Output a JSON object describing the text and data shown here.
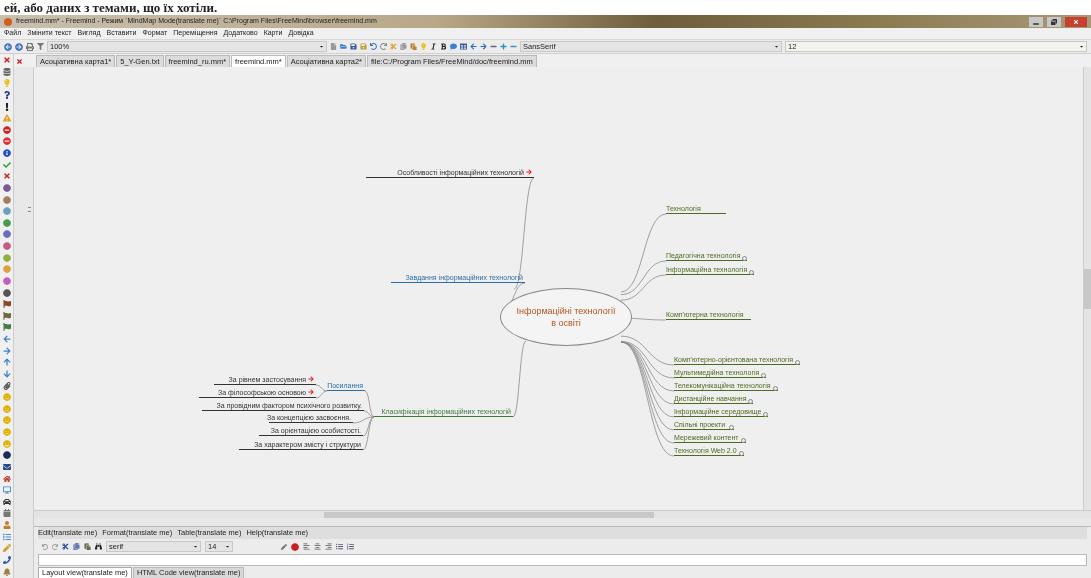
{
  "caption_fragment": "ей, або даних з темами, що їх хотіли.",
  "window": {
    "title": "freemind.mm* - Freemind - Режим `MindMap Mode(translate me)` C:\\Program Files\\FreeMind\\browser\\freemind.mm"
  },
  "menu": [
    "Файл",
    "Змінити текст",
    "Вигляд",
    "Вставити",
    "Формат",
    "Переміщення",
    "Додатково",
    "Карти",
    "Довідка"
  ],
  "toolbar": {
    "zoom": "100%",
    "font": "SansSerif",
    "size": "12"
  },
  "tabs": [
    {
      "label": "Асоціативна карта1*",
      "selected": false
    },
    {
      "label": "5_Y-Gen.txt",
      "selected": false
    },
    {
      "label": "freemind_ru.mm*",
      "selected": false
    },
    {
      "label": "freemind.mm*",
      "selected": true
    },
    {
      "label": "Асоціативна карта2*",
      "selected": false
    },
    {
      "label": "file:C:/Program Files/FreeMind/doc/freemind.mm",
      "selected": false
    }
  ],
  "mindmap": {
    "root": {
      "text": "Інформаційні технології\nв освіті"
    },
    "left": [
      {
        "text": "Особливості інформаційних технологій",
        "color": "#333333",
        "arrow_link": true,
        "folded": false
      },
      {
        "text": "Завдання інформаційних технологій",
        "color": "#2c6fa8",
        "arrow_link": false,
        "folded": false
      },
      {
        "text": "Класифікація інформаційних технологій",
        "color": "#3d7a3d",
        "arrow_link": false,
        "folded": false,
        "children": [
          {
            "text": "Посилання",
            "color": "#2c6fa8",
            "arrow_link": false,
            "folded": false,
            "children": [
              {
                "text": "За рівнем застосування",
                "color": "#333333",
                "arrow_link": true,
                "folded": false
              },
              {
                "text": "За філософською основою",
                "color": "#333333",
                "arrow_link": true,
                "folded": false
              }
            ]
          },
          {
            "text": "За провідним фактором психічного розвитку.",
            "color": "#333333",
            "arrow_link": false,
            "folded": false
          },
          {
            "text": "За концепцією засвоєння.",
            "color": "#333333",
            "arrow_link": false,
            "folded": false
          },
          {
            "text": "За орієнтацією особистості.",
            "color": "#333333",
            "arrow_link": false,
            "folded": false
          },
          {
            "text": "За характером змісту і структури",
            "color": "#333333",
            "arrow_link": false,
            "folded": false
          }
        ]
      }
    ],
    "right": [
      {
        "text": "Технологія",
        "color": "#4e6b22",
        "arrow_link": false,
        "folded": false
      },
      {
        "text": "Педагогічна технологія",
        "color": "#4e6b22",
        "arrow_link": false,
        "folded": true
      },
      {
        "text": "Інформаційна технологія",
        "color": "#4e6b22",
        "arrow_link": false,
        "folded": true
      },
      {
        "text": "Комп'ютерна технологія",
        "color": "#4e6b22",
        "arrow_link": false,
        "folded": false
      },
      {
        "text": "Комп'ютерно-орієнтована технологія",
        "color": "#4e6b22",
        "arrow_link": false,
        "folded": true
      },
      {
        "text": "Мультимедійна технологія",
        "color": "#4e6b22",
        "arrow_link": false,
        "folded": true
      },
      {
        "text": "Телекомунікаційна технологія",
        "color": "#4e6b22",
        "arrow_link": false,
        "folded": true
      },
      {
        "text": "Дистанційне навчання",
        "color": "#4e6b22",
        "arrow_link": false,
        "folded": true
      },
      {
        "text": "Інформаційне середовище",
        "color": "#4e6b22",
        "arrow_link": false,
        "folded": true
      },
      {
        "text": "Спільні проекти",
        "color": "#4e6b22",
        "arrow_link": false,
        "folded": true
      },
      {
        "text": "Мережевий контент",
        "color": "#4e6b22",
        "arrow_link": false,
        "folded": true
      },
      {
        "text": "Технологія Web 2.0",
        "color": "#4e6b22",
        "arrow_link": false,
        "folded": true
      }
    ]
  },
  "editor": {
    "menu": [
      "Edit(translate me)",
      "Format(translate me)",
      "Table(translate me)",
      "Help(translate me)"
    ],
    "font": "serif",
    "size": "14",
    "tabs": [
      {
        "label": "Layout view(translate me)",
        "selected": true
      },
      {
        "label": "HTML Code view(translate me)",
        "selected": false
      }
    ]
  }
}
